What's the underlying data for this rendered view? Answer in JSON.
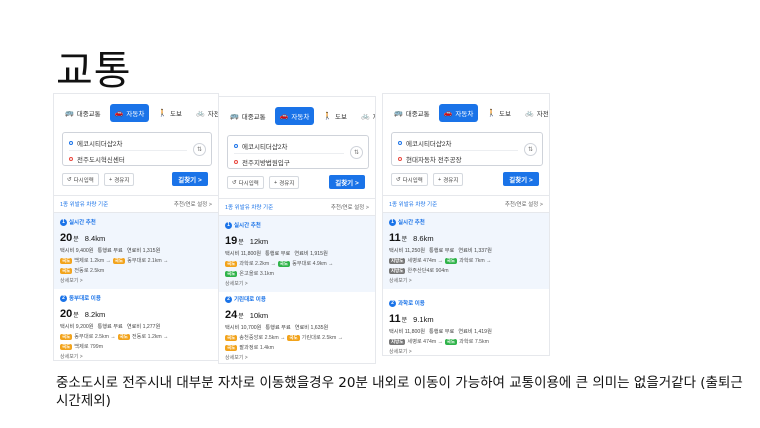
{
  "slide": {
    "title": "교통",
    "caption": "중소도시로 전주시내 대부분 자차로 이동했을경우 20분 내외로 이동이 가능하여 교통이용에 큰 의미는 없을거같다 (출퇴근 시간제외)"
  },
  "ui": {
    "tabs": [
      "대중교통",
      "자동차",
      "도보",
      "자전거"
    ],
    "via_label": "다시입력",
    "add_via_label": "경유지",
    "search_label": "길찾기 >",
    "sort_label": "추천/연료 설정 >",
    "detail_label": "상세보기 >",
    "accent_color": "#1a73e8"
  },
  "panels": [
    {
      "origin": "에코시티더샵2차",
      "destination": "전주도시혁신센터",
      "basis": "1종 위발유 차량 기준",
      "routes": [
        {
          "rank": "1",
          "label": "실시간 추천",
          "minutes": "20",
          "unit": "분",
          "distance": "8.4km",
          "fees": [
            "택시비 9,400원",
            "통행료 무료",
            "연료비 1,315원"
          ],
          "roads": [
            [
              {
                "badge": "국도",
                "color": "o"
              },
              {
                "text": "백제로 1.2km →"
              },
              {
                "badge": "국도",
                "color": "o"
              },
              {
                "text": "동부대로 2.1km →"
              }
            ],
            [
              {
                "badge": "국도",
                "color": "o"
              },
              {
                "text": "전동로 2.5km"
              }
            ]
          ]
        },
        {
          "rank": "2",
          "label": "동부대로 이용",
          "minutes": "20",
          "unit": "분",
          "distance": "8.2km",
          "fees": [
            "택시비 9,200원",
            "통행료 무료",
            "연료비 1,277원"
          ],
          "roads": [
            [
              {
                "badge": "국도",
                "color": "o"
              },
              {
                "text": "동부대로 2.5km →"
              },
              {
                "badge": "국도",
                "color": "o"
              },
              {
                "text": "전동로 1.2km →"
              }
            ],
            [
              {
                "badge": "국도",
                "color": "o"
              },
              {
                "text": "백제로 799m"
              }
            ]
          ]
        }
      ]
    },
    {
      "origin": "에코시티더샵2차",
      "destination": "전주지방법원입구",
      "basis": "1종 위발유 차량 기준",
      "routes": [
        {
          "rank": "1",
          "label": "실시간 추천",
          "minutes": "19",
          "unit": "분",
          "distance": "12km",
          "fees": [
            "택시비 11,800원",
            "통행료 무료",
            "연료비 1,915원"
          ],
          "roads": [
            [
              {
                "badge": "국도",
                "color": "o"
              },
              {
                "text": "과학로 2.2km →"
              },
              {
                "badge": "국도",
                "color": "g"
              },
              {
                "text": "동부대로 4.9km →"
              }
            ],
            [
              {
                "badge": "국도",
                "color": "g"
              },
              {
                "text": "온고을로 3.1km"
              }
            ]
          ]
        },
        {
          "rank": "2",
          "label": "기린대로 이용",
          "minutes": "24",
          "unit": "분",
          "distance": "10km",
          "fees": [
            "택시비 10,700원",
            "통행료 무료",
            "연료비 1,635원"
          ],
          "roads": [
            [
              {
                "badge": "국도",
                "color": "o"
              },
              {
                "text": "송천중앙로 2.5km →"
              },
              {
                "badge": "국도",
                "color": "o"
              },
              {
                "text": "기린대로 2.5km →"
              }
            ],
            [
              {
                "badge": "국도",
                "color": "o"
              },
              {
                "text": "팔과정로 1.4km"
              }
            ]
          ]
        }
      ]
    },
    {
      "origin": "에코시티더샵2차",
      "destination": "현대자동차 전주공장",
      "basis": "1종 위발유 차량 기준",
      "routes": [
        {
          "rank": "1",
          "label": "실시간 추천",
          "minutes": "11",
          "unit": "분",
          "distance": "8.6km",
          "fees": [
            "택시비 11,250원",
            "통행료 무료",
            "연료비 1,337원"
          ],
          "roads": [
            [
              {
                "badge": "지방도",
                "color": "k"
              },
              {
                "text": "세병로 474m →"
              },
              {
                "badge": "국도",
                "color": "g"
              },
              {
                "text": "과학로 7km →"
              }
            ],
            [
              {
                "badge": "지방도",
                "color": "k"
              },
              {
                "text": "완주산단4로 904m"
              }
            ]
          ]
        },
        {
          "rank": "2",
          "label": "과학로 이용",
          "minutes": "11",
          "unit": "분",
          "distance": "9.1km",
          "fees": [
            "택시비 11,800원",
            "통행료 무료",
            "연료비 1,419원"
          ],
          "roads": [
            [
              {
                "badge": "지방도",
                "color": "k"
              },
              {
                "text": "세병로 474m →"
              },
              {
                "badge": "국도",
                "color": "g"
              },
              {
                "text": "과학로 7.5km"
              }
            ]
          ]
        }
      ]
    }
  ]
}
